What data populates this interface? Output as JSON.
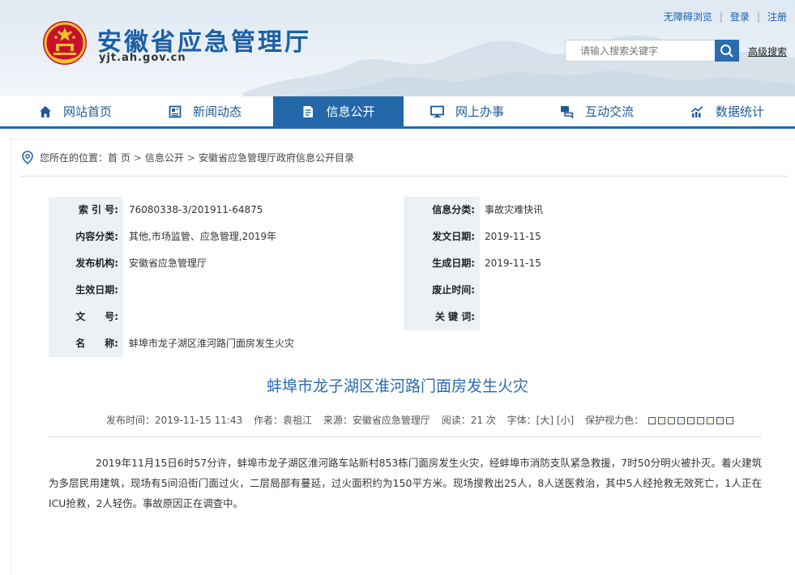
{
  "header": {
    "site_name": "安徽省应急管理厅",
    "site_domain": "yjt.ah.gov.cn",
    "top_links": [
      "无障碍浏览",
      "登录",
      "注册"
    ],
    "search": {
      "placeholder": "请输入搜索关键字",
      "advanced_label": "高级搜索"
    },
    "emblem_icon": "national-emblem",
    "brand_color": "#1b5fa4"
  },
  "nav": {
    "items": [
      {
        "label": "网站首页",
        "icon": "home-icon"
      },
      {
        "label": "新闻动态",
        "icon": "news-icon"
      },
      {
        "label": "信息公开",
        "icon": "document-icon",
        "active": true
      },
      {
        "label": "网上办事",
        "icon": "monitor-icon"
      },
      {
        "label": "互动交流",
        "icon": "chat-icon"
      },
      {
        "label": "数据统计",
        "icon": "stats-icon"
      }
    ],
    "active_color": "#2467a9"
  },
  "breadcrumb": {
    "prefix": "您所在的位置：",
    "items": [
      "首 页",
      "信息公开",
      "安徽省应急管理厅政府信息公开目录"
    ]
  },
  "meta": {
    "rows": [
      {
        "left_label": "索 引 号:",
        "left_value": "76080338-3/201911-64875",
        "right_label": "信息分类:",
        "right_value": "事故灾难快讯"
      },
      {
        "left_label": "内容分类:",
        "left_value": "其他,市场监管、应急管理,2019年",
        "right_label": "发文日期:",
        "right_value": "2019-11-15"
      },
      {
        "left_label": "发布机构:",
        "left_value": "安徽省应急管理厅",
        "right_label": "生成日期:",
        "right_value": "2019-11-15"
      },
      {
        "left_label": "生效日期:",
        "left_value": "",
        "right_label": "废止时间:",
        "right_value": ""
      },
      {
        "left_label": "文　　号:",
        "left_value": "",
        "right_label": "关 键 词:",
        "right_value": ""
      },
      {
        "left_label": "名　　称:",
        "left_value": "蚌埠市龙子湖区淮河路门面房发生火灾",
        "right_label": "",
        "right_value": ""
      }
    ]
  },
  "article": {
    "title": "蚌埠市龙子湖区淮河路门面房发生火灾",
    "publish_label": "发布时间：",
    "publish_time": "2019-11-15 11:43",
    "author_label": "作者：",
    "author": "袁祖江",
    "source_label": "来源：",
    "source": "安徽省应急管理厅",
    "views_label": "阅读：",
    "views": "21 次",
    "font_label": "字体：",
    "font_large": "[大]",
    "font_small": "[小]",
    "eye_label": "保护视力色：",
    "eye_colors": [
      "#ffffff",
      "#faf5e6",
      "#eef8ea",
      "#e9f1fb",
      "#f5eef6",
      "#f4f4f4",
      "#fff8dc",
      "#e6f2e6",
      "#f2f2f2"
    ],
    "body": "2019年11月15日6时57分许，蚌埠市龙子湖区淮河路车站新村853栋门面房发生火灾，经蚌埠市消防支队紧急救援，7时50分明火被扑灭。着火建筑为多层民用建筑，现场有5间沿街门面过火，二层局部有蔓延，过火面积约为150平方米。现场搜救出25人，8人送医救治，其中5人经抢救无效死亡，1人正在ICU抢救，2人轻伤。事故原因正在调查中。"
  }
}
